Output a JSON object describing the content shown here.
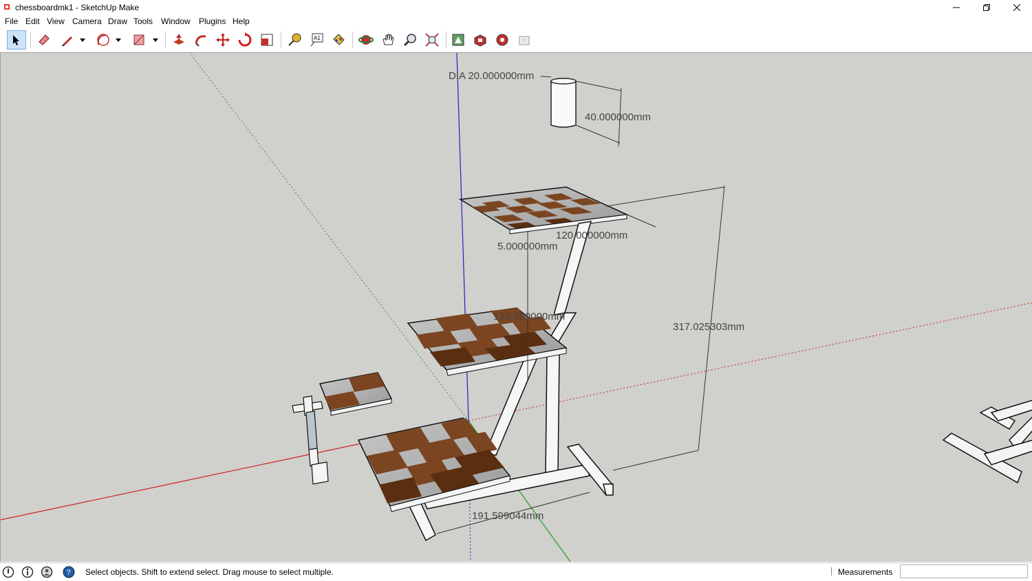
{
  "window": {
    "title": "chessboardmk1 - SketchUp Make"
  },
  "menu": {
    "items": [
      "File",
      "Edit",
      "View",
      "Camera",
      "Draw",
      "Tools",
      "Window",
      "Plugins",
      "Help"
    ]
  },
  "toolbar": {
    "tools": [
      "select-tool",
      "eraser-tool",
      "line-tool",
      "arc-tool",
      "rectangle-tool",
      "push-pull-tool",
      "follow-me-tool",
      "move-tool",
      "rotate-tool",
      "scale-tool",
      "tape-measure-tool",
      "text-tool",
      "paint-bucket-tool",
      "orbit-tool",
      "pan-tool",
      "zoom-tool",
      "zoom-extents-tool",
      "3d-warehouse-tool",
      "extension-warehouse-tool",
      "extension-manager-tool",
      "layout-tool"
    ]
  },
  "dimensions": {
    "cylinder_diameter": "DIA 20.000000mm",
    "cylinder_height": "40.000000mm",
    "top_board_width": "120.000000mm",
    "board_thickness": "5.000000mm",
    "middle_board_width": "120.000000mm",
    "total_height": "317.025303mm",
    "base_length": "191.599044mm"
  },
  "statusbar": {
    "hint": "Select objects. Shift to extend select. Drag mouse to select multiple.",
    "measurements_label": "Measurements",
    "measurements_value": ""
  },
  "colors": {
    "background": "#d0d0cc",
    "dark_square": "#7a4520",
    "light_square": "#b8b8b8",
    "red_axis": "#d02020",
    "green_axis": "#20a020",
    "blue_axis": "#2020c0"
  }
}
